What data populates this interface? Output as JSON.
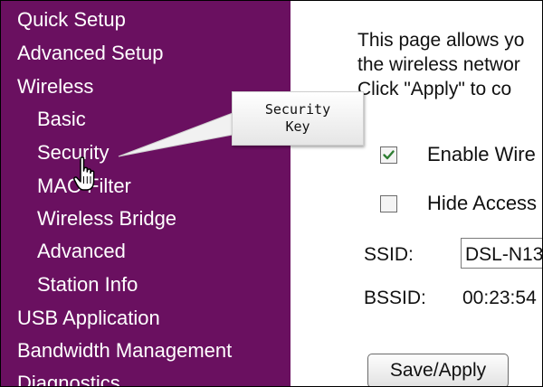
{
  "sidebar": {
    "items": [
      {
        "label": "Quick Setup"
      },
      {
        "label": "Advanced Setup"
      },
      {
        "label": "Wireless"
      },
      {
        "label": "Basic"
      },
      {
        "label": "Security"
      },
      {
        "label": "MAC Filter"
      },
      {
        "label": "Wireless Bridge"
      },
      {
        "label": "Advanced"
      },
      {
        "label": "Station Info"
      },
      {
        "label": "USB Application"
      },
      {
        "label": "Bandwidth Management"
      },
      {
        "label": "Diagnostics"
      }
    ]
  },
  "content": {
    "intro": [
      "This page allows yo",
      "the wireless networ",
      "Click \"Apply\" to co"
    ],
    "enable_wireless": {
      "label": "Enable Wire",
      "checked": true
    },
    "hide_access_point": {
      "label": "Hide Access",
      "checked": false
    },
    "ssid": {
      "label": "SSID:",
      "value": "DSL-N13"
    },
    "bssid": {
      "label": "BSSID:",
      "value": "00:23:54"
    },
    "save_button": "Save/Apply"
  },
  "callout": {
    "line1": "Security",
    "line2": "Key"
  },
  "colors": {
    "sidebar_bg": "#6a1060",
    "sidebar_text": "#ffffff",
    "checkmark": "#2e7d32"
  },
  "icons": {
    "cursor": "hand-pointer-icon",
    "checkmark": "checkmark-icon"
  }
}
